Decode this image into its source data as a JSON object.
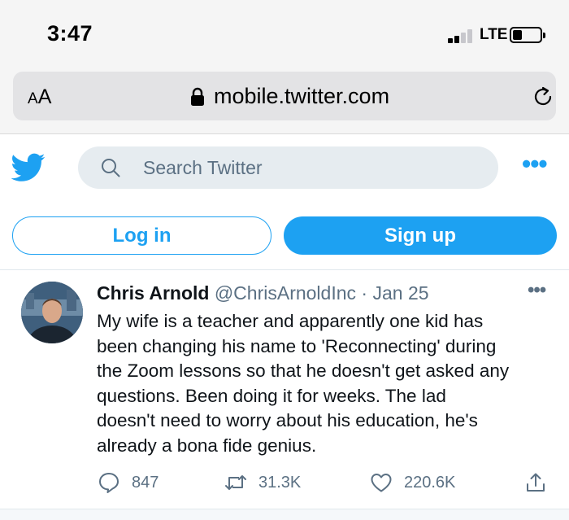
{
  "status_bar": {
    "time": "3:47",
    "network": "LTE",
    "signal_bars_active": 2,
    "signal_bars_total": 4
  },
  "browser": {
    "text_size_label_large": "A",
    "text_size_label_small": "A",
    "url": "mobile.twitter.com"
  },
  "header": {
    "search_placeholder": "Search Twitter",
    "login_label": "Log in",
    "signup_label": "Sign up"
  },
  "tweet": {
    "author_name": "Chris Arnold",
    "author_handle": "@ChrisArnoldInc",
    "separator": "·",
    "date": "Jan 25",
    "body_lines": [
      "My wife is a teacher and apparently one kid has",
      "been changing his name to 'Reconnecting' during",
      "the Zoom lessons so that he doesn't get asked any",
      "questions. Been doing it for weeks. The lad",
      "doesn't need to worry about his education, he's",
      "already a bona fide genius."
    ],
    "replies": "847",
    "retweets": "31.3K",
    "likes": "220.6K"
  },
  "colors": {
    "brand": "#1da1f2",
    "text_primary": "#0f1419",
    "text_secondary": "#5b7083",
    "search_bg": "#e6ecf0",
    "chrome_bg": "#f5f5f5"
  },
  "icons": [
    "twitter-bird-icon",
    "lock-icon",
    "reload-icon",
    "search-icon",
    "more-icon",
    "reply-icon",
    "retweet-icon",
    "like-icon",
    "share-icon",
    "battery-icon",
    "signal-icon"
  ]
}
